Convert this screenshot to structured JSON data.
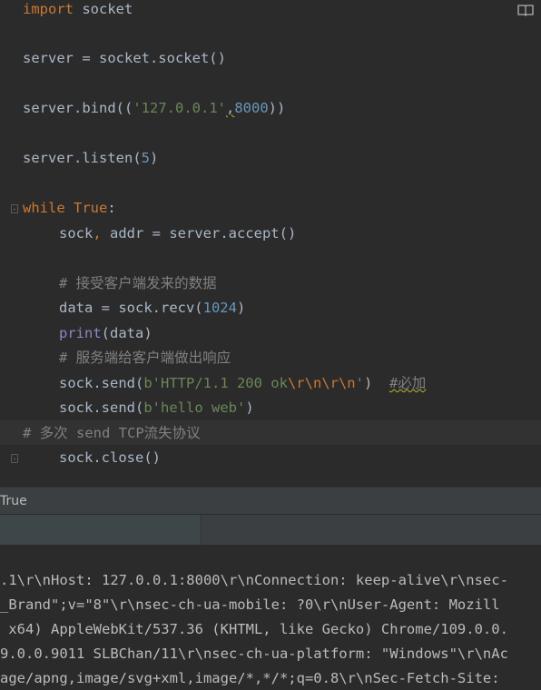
{
  "editor": {
    "lines": [
      {
        "parts": [
          [
            "kw",
            "import"
          ],
          [
            "",
            " socket"
          ]
        ]
      },
      {
        "parts": [
          [
            "",
            "server = socket.socket()"
          ]
        ]
      },
      {
        "parts": [
          [
            "",
            "server.bind(("
          ],
          [
            "str",
            "'127.0.0.1'"
          ],
          [
            "warn",
            ","
          ],
          [
            "num",
            "8000"
          ],
          [
            "",
            "))"
          ]
        ]
      },
      {
        "parts": [
          [
            "",
            "server.listen("
          ],
          [
            "num",
            "5"
          ],
          [
            "",
            ")"
          ]
        ]
      },
      {
        "parts": [
          [
            "kw",
            "while"
          ],
          [
            "",
            " "
          ],
          [
            "kw",
            "True"
          ],
          [
            "",
            ":"
          ]
        ]
      },
      {
        "parts": [
          [
            "",
            "sock"
          ],
          [
            "kw",
            ","
          ],
          [
            "",
            " addr = server.accept()"
          ]
        ]
      },
      {
        "parts": [
          [
            "cmt",
            "# 接受客户端发来的数据"
          ]
        ]
      },
      {
        "parts": [
          [
            "",
            "data = sock.recv("
          ],
          [
            "num",
            "1024"
          ],
          [
            "",
            ")"
          ]
        ]
      },
      {
        "parts": [
          [
            "bi",
            "print"
          ],
          [
            "",
            "(data)"
          ]
        ]
      },
      {
        "parts": [
          [
            "cmt",
            "# 服务端给客户端做出响应"
          ]
        ]
      },
      {
        "parts": [
          [
            "",
            "sock.send("
          ],
          [
            "str",
            "b'HTTP/1.1 200 ok"
          ],
          [
            "esc",
            "\\r\\n\\r\\n"
          ],
          [
            "str",
            "'"
          ],
          [
            "",
            ")  "
          ],
          [
            "cmtwarn",
            "#必加"
          ]
        ]
      },
      {
        "parts": [
          [
            "",
            "sock.send("
          ],
          [
            "str",
            "b'hello web'"
          ],
          [
            "",
            ")"
          ]
        ]
      },
      {
        "parts": [
          [
            "cmt",
            "# 多次 send TCP流失协议"
          ]
        ]
      },
      {
        "parts": [
          [
            "",
            "sock.close()"
          ]
        ]
      }
    ],
    "reader_icon": "book-open-icon"
  },
  "tooltip": {
    "text": "True"
  },
  "console": {
    "lines": [
      ".1\\r\\nHost: 127.0.0.1:8000\\r\\nConnection: keep-alive\\r\\nsec-",
      "_Brand\";v=\"8\"\\r\\nsec-ch-ua-mobile: ?0\\r\\nUser-Agent: Mozill",
      " x64) AppleWebKit/537.36 (KHTML, like Gecko) Chrome/109.0.0.",
      "9.0.0.9011 SLBChan/11\\r\\nsec-ch-ua-platform: \"Windows\"\\r\\nAc",
      "age/apng,image/svg+xml,image/*,*/*;q=0.8\\r\\nSec-Fetch-Site:"
    ]
  },
  "colors": {
    "background": "#2b2b2b",
    "keyword": "#cc7832",
    "string": "#6a8759",
    "number": "#6897bb",
    "comment": "#808080",
    "builtin": "#8888c6",
    "text": "#a9b7c6"
  }
}
